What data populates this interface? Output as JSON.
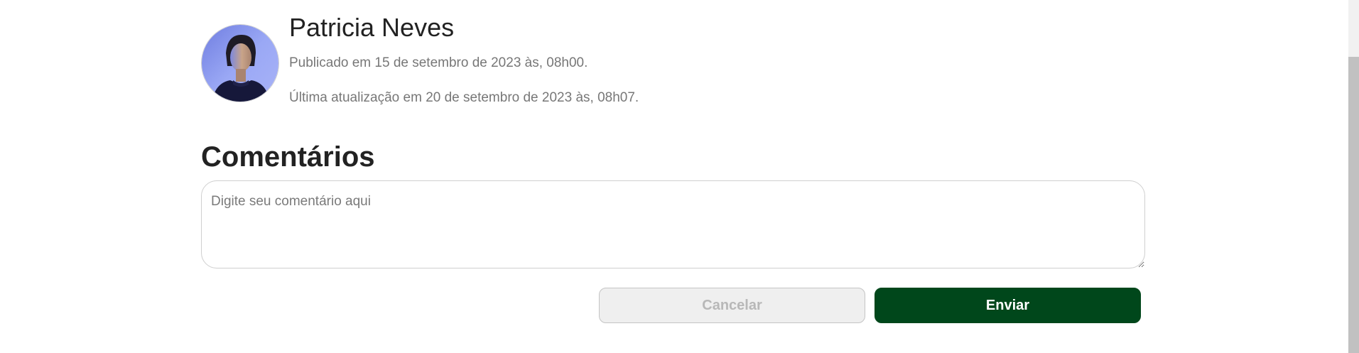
{
  "author": {
    "name": "Patricia Neves",
    "published": "Publicado em 15 de setembro de 2023 às, 08h00.",
    "updated": "Última atualização em 20 de setembro de 2023 às, 08h07."
  },
  "comments": {
    "title": "Comentários",
    "placeholder": "Digite seu comentário aqui",
    "value": "",
    "cancel_label": "Cancelar",
    "send_label": "Enviar"
  },
  "colors": {
    "send_button": "#00471b",
    "cancel_button": "#efefef",
    "avatar_background": "#8f9ef0"
  },
  "icons": {
    "avatar": "person-photo"
  }
}
